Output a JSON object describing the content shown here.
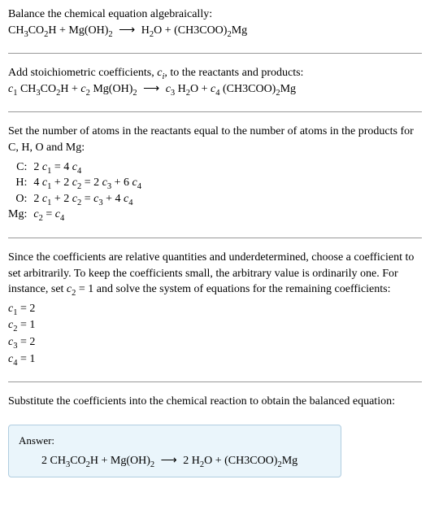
{
  "sec1": {
    "line1": "Balance the chemical equation algebraically:",
    "eq_lhs1": "CH",
    "eq_lhs2": "CO",
    "eq_lhs3": "H + Mg(OH)",
    "arrow": "⟶",
    "eq_rhs1": "H",
    "eq_rhs2": "O + (CH3COO)",
    "eq_rhs3": "Mg"
  },
  "sec2": {
    "line1a": "Add stoichiometric coefficients, ",
    "line1b": ", to the reactants and products:",
    "c1": "c",
    "c2": "c",
    "c3": "c",
    "c4": "c",
    "t1": " CH",
    "t2": "CO",
    "t3": "H + ",
    "t4": " Mg(OH)",
    "t5": " H",
    "t6": "O + ",
    "t7": " (CH3COO)",
    "t8": "Mg"
  },
  "sec3": {
    "intro": "Set the number of atoms in the reactants equal to the number of atoms in the products for C, H, O and Mg:",
    "rows": [
      {
        "label": "C:",
        "eq_a": "2 ",
        "eq_b": " = 4 "
      },
      {
        "label": "H:",
        "eq_a": "4 ",
        "eq_b": " + 2 ",
        "eq_c": " = 2 ",
        "eq_d": " + 6 "
      },
      {
        "label": "O:",
        "eq_a": "2 ",
        "eq_b": " + 2 ",
        "eq_c": " = ",
        "eq_d": " + 4 "
      },
      {
        "label": "Mg:",
        "eq_a": "",
        "eq_b": " = "
      }
    ]
  },
  "sec4": {
    "para_a": "Since the coefficients are relative quantities and underdetermined, choose a coefficient to set arbitrarily. To keep the coefficients small, the arbitrary value is ordinarily one. For instance, set ",
    "para_b": " = 1 and solve the system of equations for the remaining coefficients:",
    "coeffs": [
      {
        "pre": "",
        "n": "1",
        "val": " = 2"
      },
      {
        "pre": "",
        "n": "2",
        "val": " = 1"
      },
      {
        "pre": "",
        "n": "3",
        "val": " = 2"
      },
      {
        "pre": "",
        "n": "4",
        "val": " = 1"
      }
    ]
  },
  "sec5": {
    "para": "Substitute the coefficients into the chemical reaction to obtain the balanced equation:"
  },
  "answer": {
    "label": "Answer:",
    "p1": "2 CH",
    "p2": "CO",
    "p3": "H + Mg(OH)",
    "p4": "2 H",
    "p5": "O + (CH3COO)",
    "p6": "Mg"
  },
  "chart_data": {
    "type": "table",
    "title": "Balancing CH3CO2H + Mg(OH)2 → H2O + (CH3COO)2Mg",
    "atom_balance": [
      {
        "element": "C",
        "equation": "2 c1 = 4 c4"
      },
      {
        "element": "H",
        "equation": "4 c1 + 2 c2 = 2 c3 + 6 c4"
      },
      {
        "element": "O",
        "equation": "2 c1 + 2 c2 = c3 + 4 c4"
      },
      {
        "element": "Mg",
        "equation": "c2 = c4"
      }
    ],
    "solution": {
      "c1": 2,
      "c2": 1,
      "c3": 2,
      "c4": 1
    },
    "balanced_equation": "2 CH3CO2H + Mg(OH)2 ⟶ 2 H2O + (CH3COO)2Mg"
  }
}
